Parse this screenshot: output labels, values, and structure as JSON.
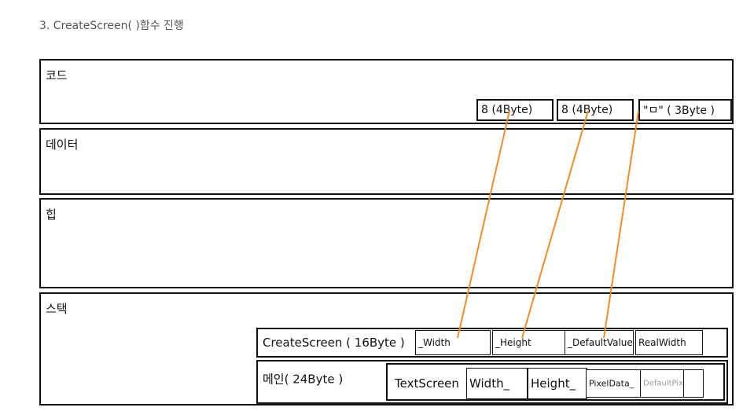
{
  "caption": "3. CreateScreen( )함수 진행",
  "regions": {
    "code": "코드",
    "data": "데이터",
    "heap": "힙",
    "stack": "스택"
  },
  "code_boxes": [
    "8 (4Byte)",
    "8 (4Byte)",
    "\"ㅁ\" ( 3Byte )"
  ],
  "stack_frames": {
    "create": {
      "label": "CreateScreen ( 16Byte )",
      "cells": [
        "_Width",
        "_Height",
        "_DefaultValue",
        "RealWidth"
      ]
    },
    "main": {
      "label": "메인( 24Byte )",
      "cells": [
        "TextScreen",
        "Width_",
        "Height_",
        "PixelData_",
        "DefaultPixel_",
        ""
      ]
    }
  },
  "colors": {
    "arrow": "#f28c28",
    "border": "#111111"
  }
}
